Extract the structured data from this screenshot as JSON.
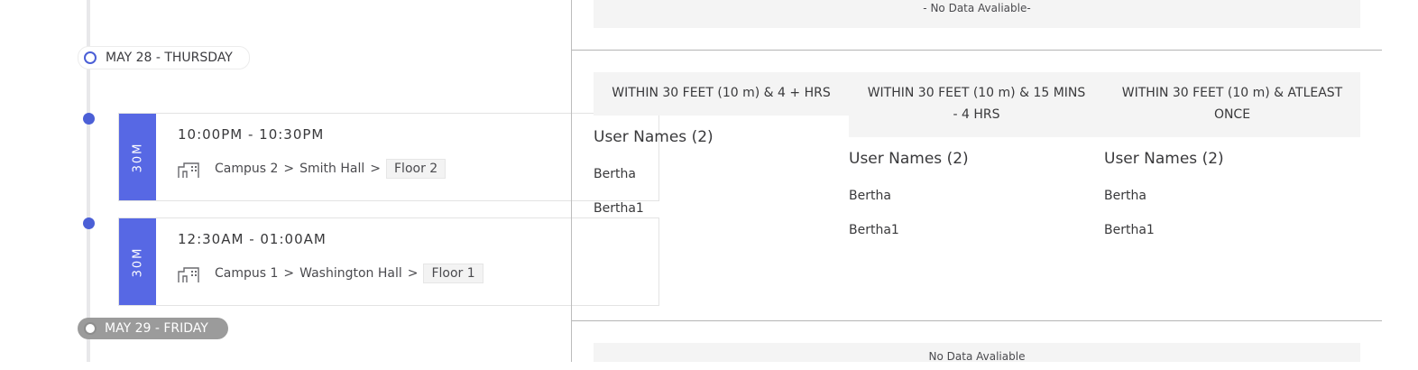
{
  "timeline": {
    "dates": [
      {
        "label": "MAY 28 - THURSDAY",
        "state": "active"
      },
      {
        "label": "MAY 29 - FRIDAY",
        "state": "inactive"
      }
    ],
    "visits": [
      {
        "duration": "30M",
        "time": "10:00PM - 10:30PM",
        "campus": "Campus 2",
        "building": "Smith Hall",
        "floor": "Floor 2",
        "icon": "building-icon"
      },
      {
        "duration": "30M",
        "time": "12:30AM - 01:00AM",
        "campus": "Campus 1",
        "building": "Washington Hall",
        "floor": "Floor 1",
        "icon": "building-icon"
      }
    ],
    "separator": ">"
  },
  "panel": {
    "top_no_data": "- No Data Avaliable-",
    "bottom_no_data": "No Data Avaliable",
    "columns": [
      {
        "header": "WITHIN 30 FEET (10 m) & 4 + HRS",
        "users_title": "User Names (2)",
        "users": [
          "Bertha",
          "Bertha1"
        ]
      },
      {
        "header_line1": "WITHIN 30 FEET (10 m) & 15 MINS",
        "header_line2": "- 4 HRS",
        "users_title": "User Names (2)",
        "users": [
          "Bertha",
          "Bertha1"
        ]
      },
      {
        "header_line1": "WITHIN 30 FEET (10 m) & ATLEAST",
        "header_line2": "ONCE",
        "users_title": "User Names (2)",
        "users": [
          "Bertha",
          "Bertha1"
        ]
      }
    ]
  },
  "colors": {
    "accent": "#5768e4",
    "dot": "#4b5fd6",
    "inactive_pill": "#9b9b9b",
    "panel_bg": "#f4f4f4"
  }
}
